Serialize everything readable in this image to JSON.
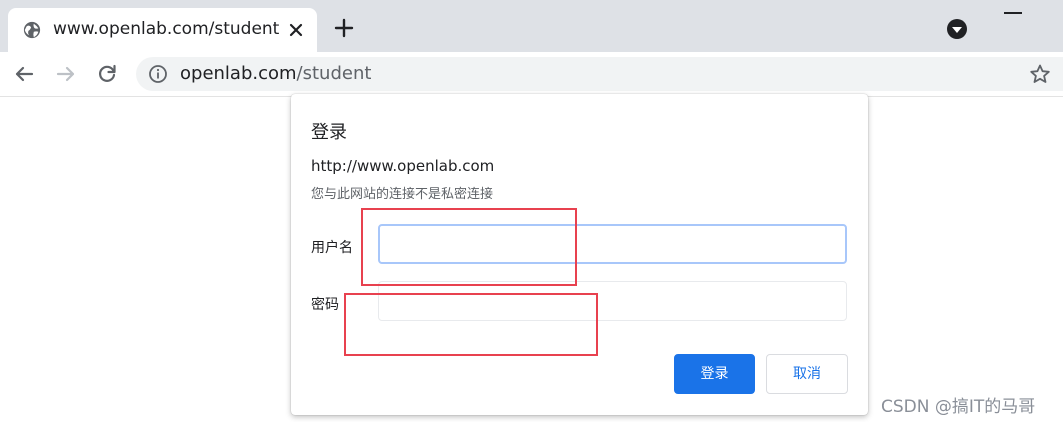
{
  "browser": {
    "tab": {
      "title": "www.openlab.com/student",
      "favicon": "globe-icon",
      "close_icon": "close-icon"
    },
    "new_tab_icon": "plus-icon",
    "profile_icon": "profile-icon",
    "window_minimize_icon": "minimize-icon",
    "toolbar": {
      "back_icon": "arrow-left-icon",
      "forward_icon": "arrow-right-icon",
      "reload_icon": "reload-icon",
      "omnibox": {
        "security_icon": "info-circle-icon",
        "url_host": "openlab.com",
        "url_path": "/student",
        "bookmark_icon": "star-icon"
      }
    }
  },
  "auth_dialog": {
    "title": "登录",
    "origin": "http://www.openlab.com",
    "warning": "您与此网站的连接不是私密连接",
    "username_label": "用户名",
    "username_value": "",
    "password_label": "密码",
    "password_value": "",
    "login_button": "登录",
    "cancel_button": "取消"
  },
  "watermark": "CSDN @搞IT的马哥",
  "colors": {
    "primary": "#1a73e8",
    "annotation": "#e8414f",
    "tabstrip": "#dee1e6",
    "omnibox_bg": "#f1f3f4"
  }
}
